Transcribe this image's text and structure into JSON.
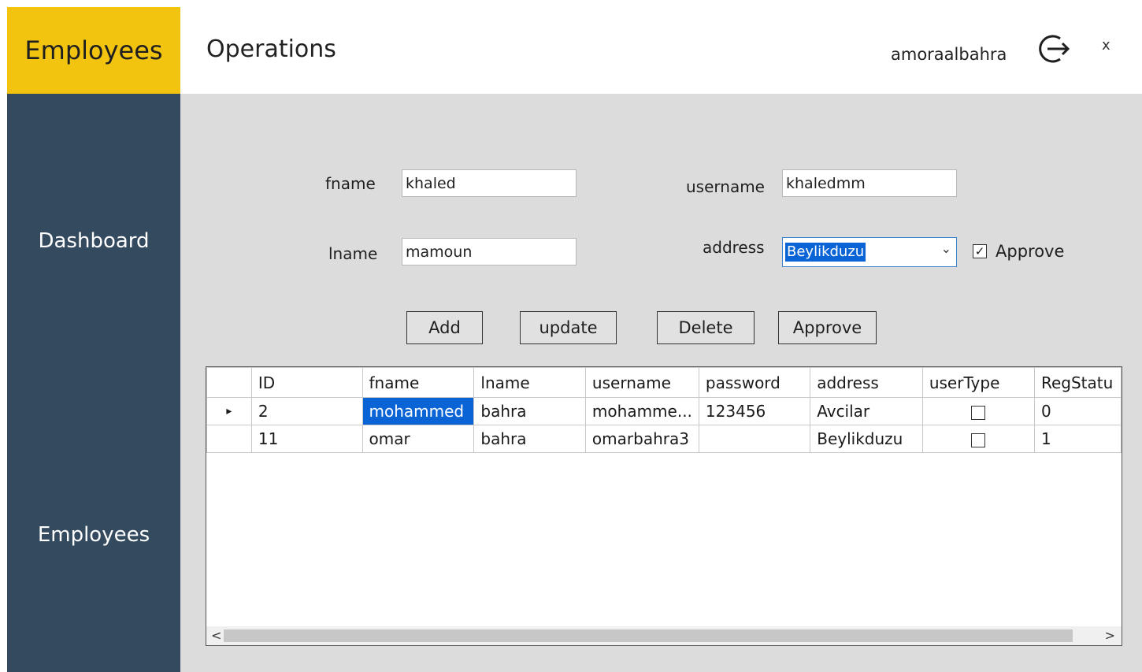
{
  "brand": {
    "title": "Employees",
    "color": "#f2c40f"
  },
  "sidebar": {
    "color": "#344a5f",
    "items": [
      {
        "label": "Dashboard"
      },
      {
        "label": "Employees"
      }
    ]
  },
  "header": {
    "title": "Operations",
    "user": "amoraalbahra",
    "close_label": "x",
    "logout_icon": "logout-icon"
  },
  "form": {
    "fname_label": "fname",
    "fname_value": "khaled",
    "lname_label": "lname",
    "lname_value": "mamoun",
    "username_label": "username",
    "username_value": "khaledmm",
    "address_label": "address",
    "address_value": "Beylikduzu",
    "approve_label": "Approve",
    "approve_checked": true
  },
  "buttons": {
    "add": "Add",
    "update": "update",
    "delete": "Delete",
    "approve": "Approve"
  },
  "grid": {
    "columns": [
      "ID",
      "fname",
      "lname",
      "username",
      "password",
      "address",
      "userType",
      "RegStatu"
    ],
    "rows": [
      {
        "marker": "▸",
        "ID": "2",
        "fname": "mohammed",
        "lname": "bahra",
        "username": "mohamme...",
        "password": "123456",
        "address": "Avcilar",
        "userType": false,
        "RegStatu": "0"
      },
      {
        "marker": "",
        "ID": "11",
        "fname": "omar",
        "lname": "bahra",
        "username": "omarbahra3",
        "password": "",
        "address": "Beylikduzu",
        "userType": false,
        "RegStatu": "1"
      }
    ],
    "scroll_left": "<",
    "scroll_right": ">"
  }
}
